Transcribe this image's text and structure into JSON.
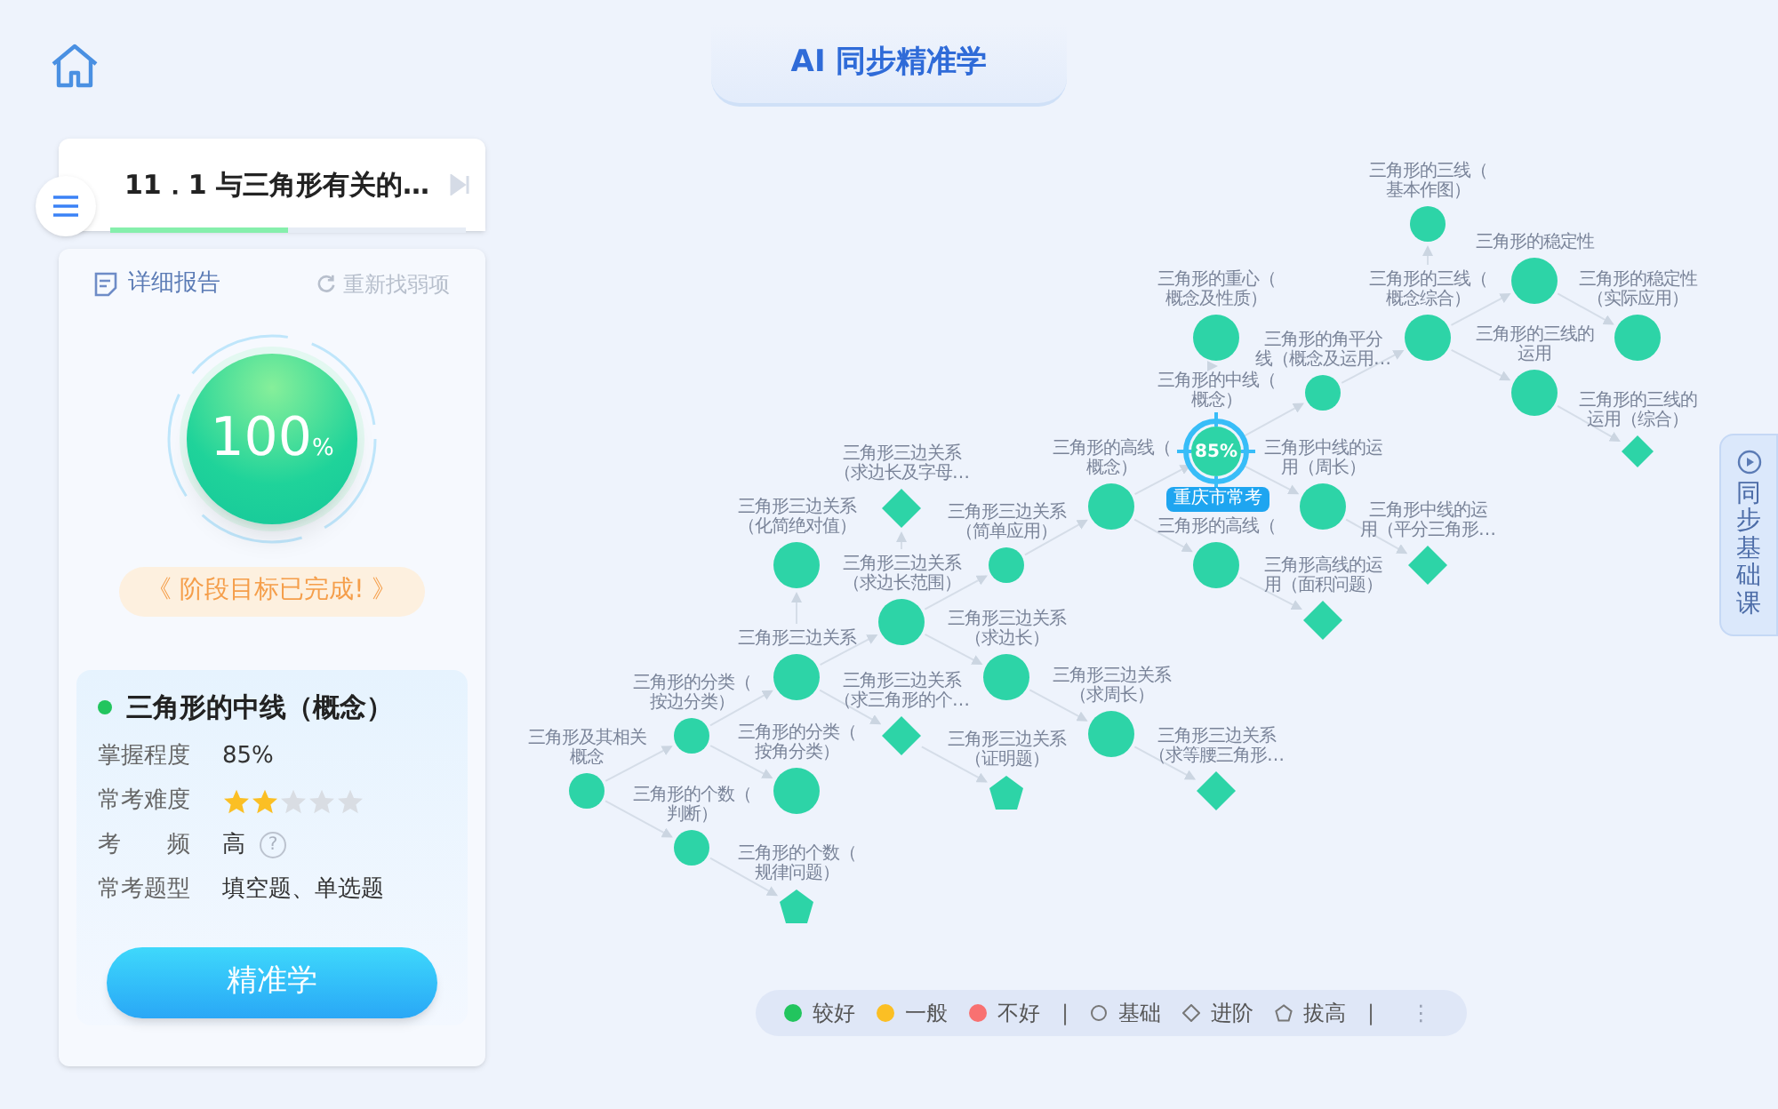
{
  "header": {
    "title": "AI 同步精准学"
  },
  "chapter": {
    "title": "11．1 与三角形有关的…",
    "level": 0.5
  },
  "report": {
    "link": "详细报告",
    "refresh": "重新找弱项",
    "score": "100",
    "unit": "%",
    "goal": "《 阶段目标已完成! 》"
  },
  "point": {
    "title": "三角形的中线（概念）",
    "color": "#22c55e",
    "rows": [
      {
        "kind": "text",
        "label": "掌握程度",
        "value": "85%"
      },
      {
        "kind": "stars",
        "label": "常考难度",
        "stars": 2
      },
      {
        "kind": "help",
        "label": "考　　频",
        "value": "高",
        "icon": "?"
      },
      {
        "kind": "text",
        "label": "常考题型",
        "value": "填空题、单选题"
      }
    ],
    "button": "精准学"
  },
  "side_tab": {
    "label": "同步基础课"
  },
  "graph": {
    "nodes": [
      {
        "label": [
          "三角形的三线（",
          "基本作图）"
        ],
        "kind": "basic",
        "selected": false
      },
      {
        "label": [
          "三角形的稳定性"
        ],
        "kind": "basic",
        "selected": false
      },
      {
        "label": [
          "三角形的重心（",
          "概念及性质）"
        ],
        "kind": "basic",
        "selected": false
      },
      {
        "label": [
          "三角形的三线（",
          "概念综合）"
        ],
        "kind": "basic",
        "selected": false
      },
      {
        "label": [
          "三角形的稳定性",
          "（实际应用）"
        ],
        "kind": "basic",
        "selected": false
      },
      {
        "label": [
          "三角形的角平分",
          "线（概念及运用…"
        ],
        "kind": "basic",
        "selected": false
      },
      {
        "label": [
          "三角形的三线的",
          "运用"
        ],
        "kind": "basic",
        "selected": false
      },
      {
        "label": [
          "三角形的中线（",
          "概念）"
        ],
        "kind": "basic",
        "selected": true,
        "value": "85%",
        "badge": "重庆市常考"
      },
      {
        "label": [
          "三角形的三线的",
          "运用（综合）"
        ],
        "kind": "advanced",
        "selected": false
      },
      {
        "label": [
          "三角形三边关系",
          "（求边长及字母…"
        ],
        "kind": "advanced",
        "selected": false
      },
      {
        "label": [
          "三角形的高线（",
          "概念）"
        ],
        "kind": "basic",
        "selected": false
      },
      {
        "label": [
          "三角形中线的运",
          "用（周长）"
        ],
        "kind": "basic",
        "selected": false
      },
      {
        "label": [
          "三角形三边关系",
          "（化简绝对值）"
        ],
        "kind": "basic",
        "selected": false
      },
      {
        "label": [
          "三角形三边关系",
          "（简单应用）"
        ],
        "kind": "basic",
        "selected": false
      },
      {
        "label": [
          "三角形的高线（"
        ],
        "kind": "basic",
        "selected": false
      },
      {
        "label": [
          "三角形中线的运",
          "用（平分三角形…"
        ],
        "kind": "advanced",
        "selected": false
      },
      {
        "label": [
          "三角形三边关系",
          "（求边长范围）"
        ],
        "kind": "basic",
        "selected": false
      },
      {
        "label": [
          "三角形高线的运",
          "用（面积问题）"
        ],
        "kind": "advanced",
        "selected": false
      },
      {
        "label": [
          "三角形三边关系"
        ],
        "kind": "basic",
        "selected": false
      },
      {
        "label": [
          "三角形三边关系",
          "（求边长）"
        ],
        "kind": "basic",
        "selected": false
      },
      {
        "label": [
          "三角形的分类（",
          "按边分类）"
        ],
        "kind": "basic",
        "selected": false
      },
      {
        "label": [
          "三角形三边关系",
          "（求三角形的个…"
        ],
        "kind": "advanced",
        "selected": false
      },
      {
        "label": [
          "三角形三边关系",
          "（求周长）"
        ],
        "kind": "basic",
        "selected": false
      },
      {
        "label": [
          "三角形及其相关",
          "概念"
        ],
        "kind": "basic",
        "selected": false
      },
      {
        "label": [
          "三角形的分类（",
          "按角分类）"
        ],
        "kind": "basic",
        "selected": false
      },
      {
        "label": [
          "三角形三边关系",
          "（证明题）"
        ],
        "kind": "elevated",
        "selected": false
      },
      {
        "label": [
          "三角形三边关系",
          "（求等腰三角形…"
        ],
        "kind": "advanced",
        "selected": false
      },
      {
        "label": [
          "三角形的个数（",
          "判断）"
        ],
        "kind": "basic",
        "selected": false
      },
      {
        "label": [
          "三角形的个数（",
          "规律问题）"
        ],
        "kind": "elevated",
        "selected": false
      }
    ]
  },
  "legend": [
    {
      "kind": "dot",
      "label": "较好",
      "color": "#22c55e"
    },
    {
      "kind": "dot",
      "label": "一般",
      "color": "#fbbf24"
    },
    {
      "kind": "dot",
      "label": "不好",
      "color": "#f87171"
    },
    {
      "kind": "divider",
      "label": "|"
    },
    {
      "kind": "circle",
      "label": "基础"
    },
    {
      "kind": "diamond",
      "label": "进阶"
    },
    {
      "kind": "pentagon",
      "label": "拔高"
    },
    {
      "kind": "divider",
      "label": "|"
    },
    {
      "kind": "more",
      "label": "⋮"
    }
  ]
}
